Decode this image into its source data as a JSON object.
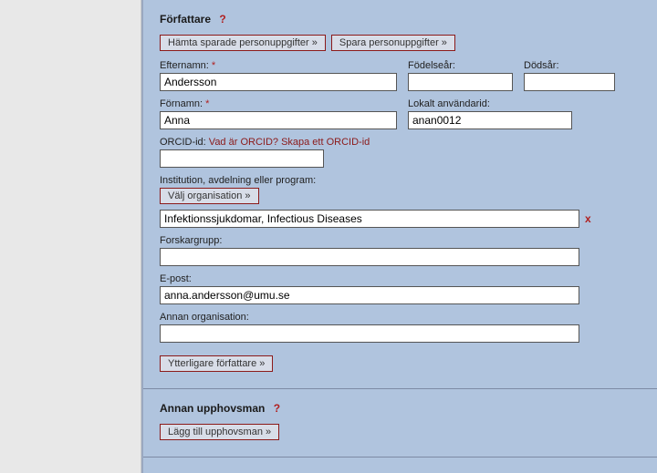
{
  "author": {
    "title": "Författare",
    "buttons": {
      "fetch": "Hämta sparade personuppgifter »",
      "save": "Spara personuppgifter »"
    },
    "lastname": {
      "label": "Efternamn:",
      "value": "Andersson"
    },
    "firstname": {
      "label": "Förnamn:",
      "value": "Anna"
    },
    "birthyear": {
      "label": "Födelseår:",
      "value": ""
    },
    "deathyear": {
      "label": "Dödsår:",
      "value": ""
    },
    "localuser": {
      "label": "Lokalt användarid:",
      "value": "anan0012"
    },
    "orcid": {
      "label": "ORCID-id:",
      "link": "Vad är ORCID? Skapa ett ORCID-id",
      "value": ""
    },
    "institution": {
      "label": "Institution, avdelning eller program:",
      "choose": "Välj organisation »",
      "value": "Infektionssjukdomar, Infectious Diseases"
    },
    "researchgroup": {
      "label": "Forskargrupp:",
      "value": ""
    },
    "email": {
      "label": "E-post:",
      "value": "anna.andersson@umu.se"
    },
    "otherorg": {
      "label": "Annan organisation:",
      "value": ""
    },
    "more": "Ytterligare författare »"
  },
  "other": {
    "title": "Annan upphovsman",
    "add": "Lägg till upphovsman »"
  },
  "glyphs": {
    "help": "?",
    "required": "*",
    "remove": "x"
  }
}
